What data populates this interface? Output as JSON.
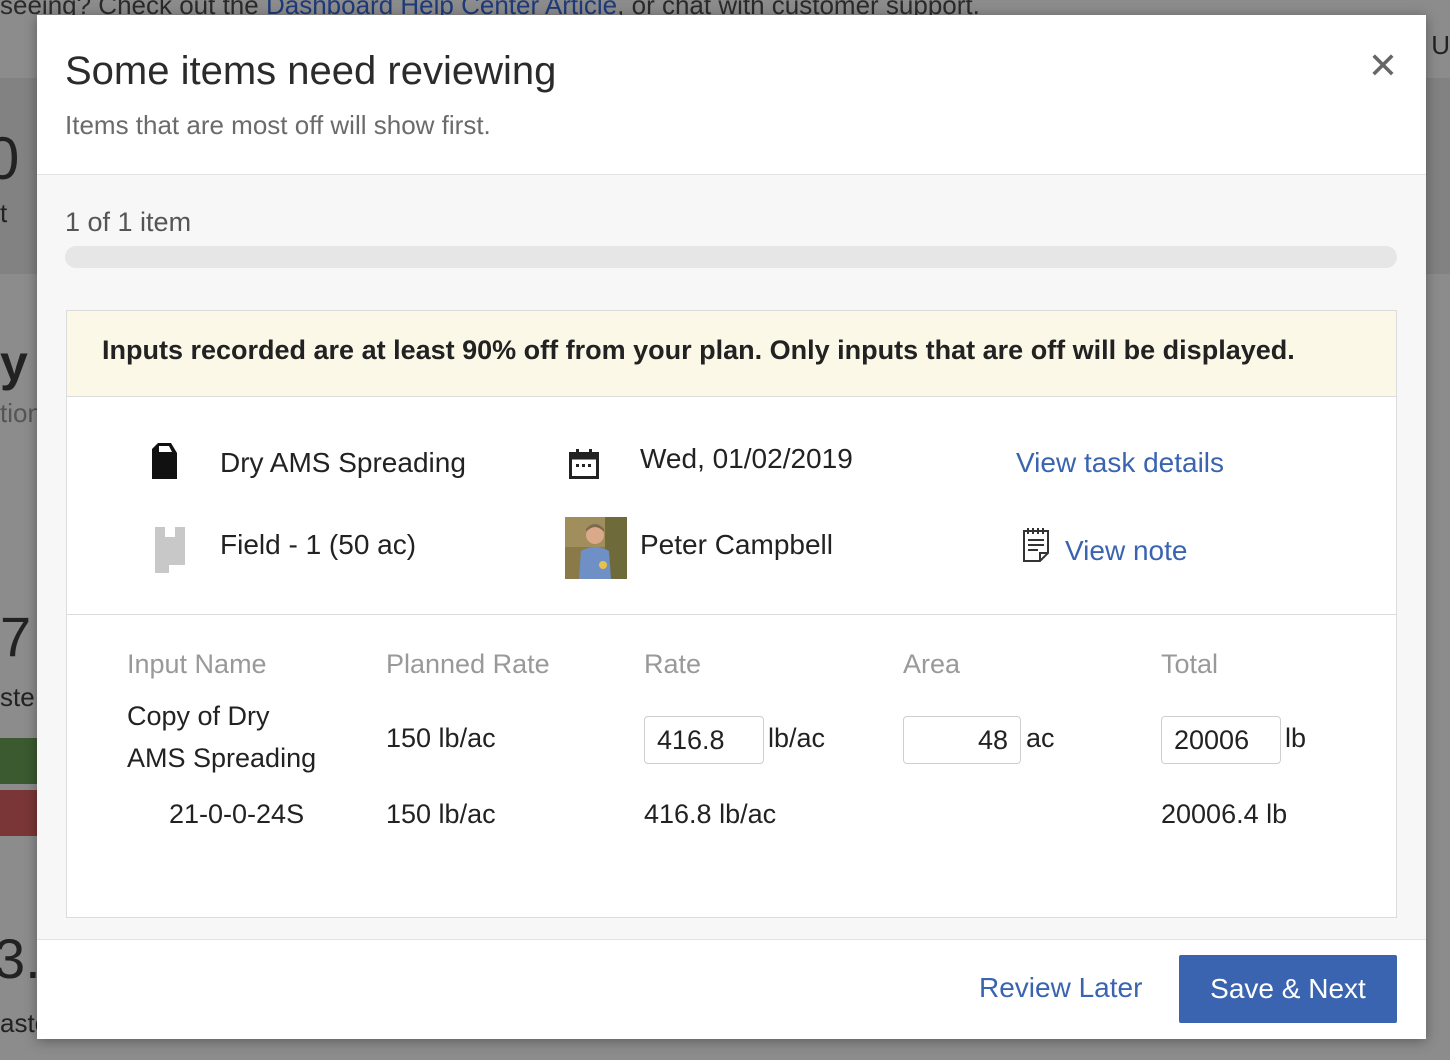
{
  "background": {
    "top_line_text": "seeing? Check out the ",
    "top_line_link": "Dashboard Help Center Article",
    "top_line_suffix": ", or chat with customer support.",
    "frag_right_top": ": U",
    "frag_big_00": "0",
    "frag_t": "t",
    "frag_y": "y",
    "frag_tion": "tion",
    "frag_7": "7",
    "frag_ste": "ste",
    "frag_3": "3.",
    "frag_aste": "aste"
  },
  "modal": {
    "title": "Some items need reviewing",
    "subtitle": "Items that are most off will show first.",
    "close_icon": "close-icon",
    "progress_label": "1 of 1 item",
    "progress": 0
  },
  "warning": {
    "text": "Inputs recorded are at least 90% off from your plan. Only inputs that are off will be displayed."
  },
  "task": {
    "name": "Dry AMS Spreading",
    "date": "Wed, 01/02/2019",
    "view_task_details": "View task details",
    "field": "Field - 1 (50 ac)",
    "person": "Peter Campbell",
    "view_note": "View note"
  },
  "inputs": {
    "headers": [
      "Input Name",
      "Planned Rate",
      "Rate",
      "Area",
      "Total"
    ],
    "main_row": {
      "name_line1": "Copy of Dry",
      "name_line2": "AMS Spreading",
      "planned_rate": "150  lb/ac",
      "rate_value": "416.8",
      "rate_unit": "lb/ac",
      "area_value": "48",
      "area_unit": "ac",
      "total_value": "20006",
      "total_unit": "lb"
    },
    "sub_row": {
      "name": "21-0-0-24S",
      "planned_rate": "150  lb/ac",
      "rate": "416.8 lb/ac",
      "total": "20006.4 lb"
    }
  },
  "footer": {
    "review_later": "Review Later",
    "save_next": "Save & Next"
  },
  "colors": {
    "link": "#3a64b0",
    "primary_button": "#3a64b0",
    "warning_bg": "#fcf8e8"
  }
}
